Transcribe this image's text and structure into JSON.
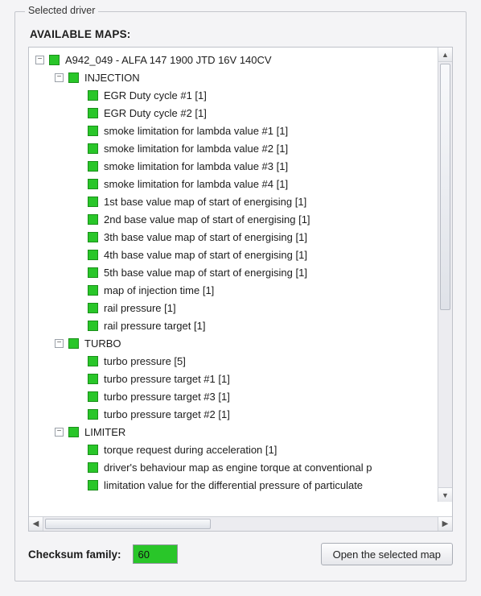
{
  "group": {
    "legend": "Selected driver"
  },
  "header": "AVAILABLE MAPS:",
  "tree": {
    "root": {
      "expanded": true,
      "label": "A942_049 - ALFA 147 1900 JTD 16V 140CV",
      "children": [
        {
          "expanded": true,
          "label": "INJECTION",
          "children": [
            {
              "label": "EGR Duty cycle #1  [1]"
            },
            {
              "label": "EGR Duty cycle #2  [1]"
            },
            {
              "label": "smoke limitation for lambda value #1  [1]"
            },
            {
              "label": "smoke limitation for lambda value #2  [1]"
            },
            {
              "label": "smoke limitation for lambda value #3  [1]"
            },
            {
              "label": "smoke limitation for lambda value #4  [1]"
            },
            {
              "label": "1st base value map of start of energising  [1]"
            },
            {
              "label": "2nd base value map of start of energising  [1]"
            },
            {
              "label": "3th base value map of start of energising  [1]"
            },
            {
              "label": "4th base value map of start of energising  [1]"
            },
            {
              "label": "5th base value map of start of energising  [1]"
            },
            {
              "label": "map of injection time  [1]"
            },
            {
              "label": "rail pressure  [1]"
            },
            {
              "label": "rail pressure target  [1]"
            }
          ]
        },
        {
          "expanded": true,
          "label": "TURBO",
          "children": [
            {
              "label": "turbo pressure  [5]"
            },
            {
              "label": "turbo pressure target #1  [1]"
            },
            {
              "label": "turbo pressure target #3  [1]"
            },
            {
              "label": "turbo pressure target #2  [1]"
            }
          ]
        },
        {
          "expanded": true,
          "label": "LIMITER",
          "children": [
            {
              "label": "torque request during acceleration  [1]"
            },
            {
              "label": "driver's behaviour map as engine torque at conventional p"
            },
            {
              "label": "limitation value for the differential pressure of particulate"
            }
          ]
        }
      ]
    }
  },
  "checksum": {
    "label": "Checksum family:",
    "value": "60"
  },
  "actions": {
    "open_label": "Open the selected map"
  },
  "glyphs": {
    "minus": "−",
    "up": "▲",
    "down": "▼",
    "left": "◀",
    "right": "▶"
  }
}
